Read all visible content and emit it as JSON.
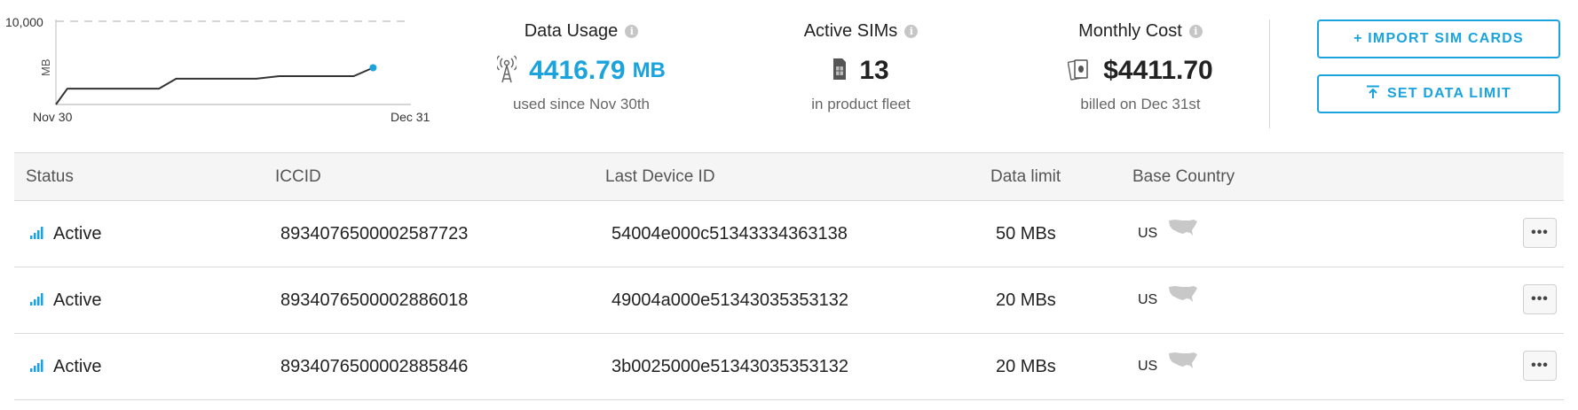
{
  "usage_chart": {
    "y_max_label": "10,000",
    "y_unit": "MB",
    "x_start": "Nov 30",
    "x_end": "Dec 31",
    "colors": {
      "line": "#333333",
      "endpoint": "#1aa3dc",
      "grid": "#bdbdbd"
    }
  },
  "chart_data": {
    "type": "line",
    "title": "",
    "xlabel": "",
    "ylabel": "MB",
    "xlim": [
      0,
      31
    ],
    "ylim": [
      0,
      10000
    ],
    "x_tick_labels": [
      "Nov 30",
      "Dec 31"
    ],
    "y_tick_labels": [
      "10,000"
    ],
    "series": [
      {
        "x": [
          0,
          1,
          9,
          10.5,
          17.5,
          19.5,
          26,
          27.7
        ],
        "y": [
          0,
          1900,
          1900,
          3100,
          3100,
          3400,
          3400,
          4416.79
        ]
      }
    ]
  },
  "stats": {
    "data_usage": {
      "title": "Data Usage",
      "value": "4416.79",
      "unit": "MB",
      "subtitle": "used since Nov 30th",
      "icon": "antenna-icon"
    },
    "active_sims": {
      "title": "Active SIMs",
      "value": "13",
      "subtitle": "in product fleet",
      "icon": "sim-card-icon"
    },
    "monthly_cost": {
      "title": "Monthly Cost",
      "value": "$4411.70",
      "subtitle": "billed on Dec 31st",
      "icon": "money-icon"
    },
    "info_glyph": "i"
  },
  "actions": {
    "import_label": "+ IMPORT SIM CARDS",
    "set_limit_label": "SET DATA LIMIT"
  },
  "table": {
    "headers": {
      "status": "Status",
      "iccid": "ICCID",
      "device": "Last Device ID",
      "limit": "Data limit",
      "country": "Base Country"
    },
    "more_glyph": "•••",
    "rows": [
      {
        "status": "Active",
        "iccid": "8934076500002587723",
        "device": "54004e000c51343334363138",
        "limit": "50 MBs",
        "country": "US"
      },
      {
        "status": "Active",
        "iccid": "8934076500002886018",
        "device": "49004a000e51343035353132",
        "limit": "20 MBs",
        "country": "US"
      },
      {
        "status": "Active",
        "iccid": "8934076500002885846",
        "device": "3b0025000e51343035353132",
        "limit": "20 MBs",
        "country": "US"
      }
    ]
  },
  "colors": {
    "accent": "#1aa3dc",
    "map_gray": "#c8c8c8"
  }
}
